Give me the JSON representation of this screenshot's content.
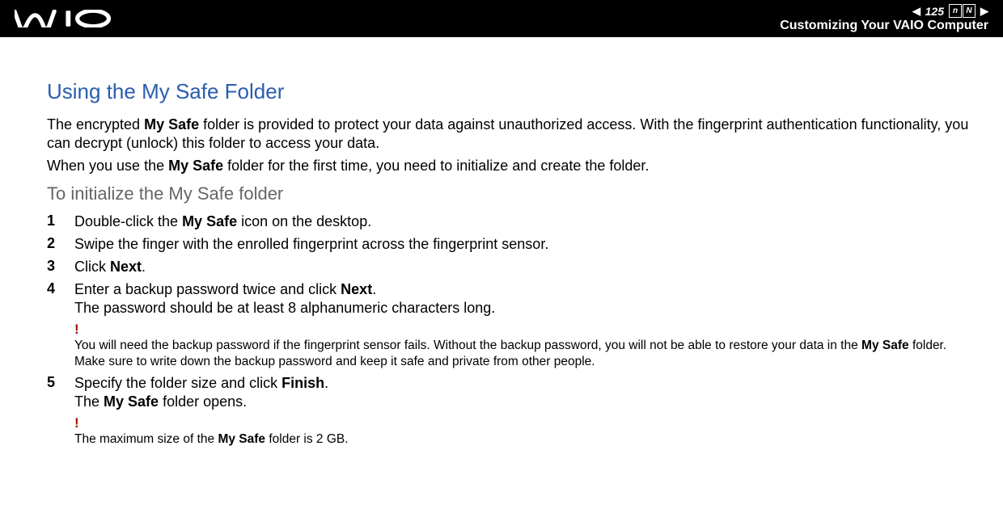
{
  "header": {
    "page_number": "125",
    "nav_letters": [
      "n",
      "N"
    ],
    "title": "Customizing Your VAIO Computer"
  },
  "main": {
    "heading": "Using the My Safe Folder",
    "para1_pre": "The encrypted ",
    "para1_bold": "My Safe",
    "para1_post": " folder is provided to protect your data against unauthorized access. With the fingerprint authentication functionality, you can decrypt (unlock) this folder to access your data.",
    "para2_pre": "When you use the ",
    "para2_bold": "My Safe",
    "para2_post": " folder for the first time, you need to initialize and create the folder.",
    "subheading": "To initialize the My Safe folder",
    "steps": [
      {
        "num": "1",
        "pre": "Double-click the ",
        "b": "My Safe",
        "post": " icon on the desktop."
      },
      {
        "num": "2",
        "pre": "Swipe the finger with the enrolled fingerprint across the fingerprint sensor.",
        "b": "",
        "post": ""
      },
      {
        "num": "3",
        "pre": "Click ",
        "b": "Next",
        "post": "."
      },
      {
        "num": "4",
        "pre": "Enter a backup password twice and click ",
        "b": "Next",
        "post": ".",
        "extra": "The password should be at least 8 alphanumeric characters long."
      },
      {
        "num": "5",
        "pre": "Specify the folder size and click ",
        "b": "Finish",
        "post": ".",
        "extra_pre": "The ",
        "extra_b": "My Safe",
        "extra_post": " folder opens."
      }
    ],
    "warn1_pre": "You will need the backup password if the fingerprint sensor fails. Without the backup password, you will not be able to restore your data in the ",
    "warn1_b": "My Safe",
    "warn1_post": " folder. Make sure to write down the backup password and keep it safe and private from other people.",
    "warn2_pre": "The maximum size of the ",
    "warn2_b": "My Safe",
    "warn2_post": " folder is 2 GB.",
    "bang": "!"
  }
}
